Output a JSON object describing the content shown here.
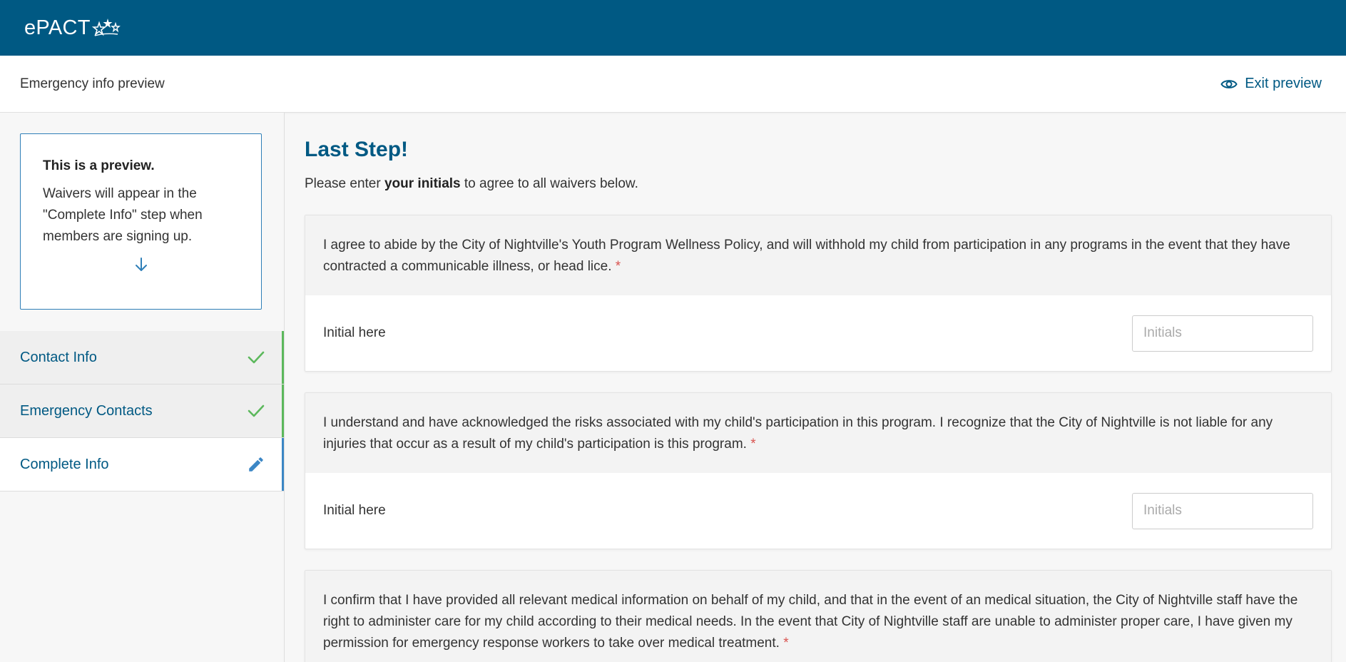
{
  "app": {
    "logo_text": "ePACT"
  },
  "subheader": {
    "title": "Emergency info preview",
    "exit_label": "Exit preview"
  },
  "preview_notice": {
    "title": "This is a preview.",
    "body": "Waivers will appear in the \"Complete Info\" step when members are signing up."
  },
  "steps": [
    {
      "label": "Contact Info",
      "status": "done",
      "icon": "check-icon"
    },
    {
      "label": "Emergency Contacts",
      "status": "done",
      "icon": "check-icon"
    },
    {
      "label": "Complete Info",
      "status": "current",
      "icon": "pencil-icon"
    }
  ],
  "main": {
    "heading": "Last Step!",
    "instructions_prefix": "Please enter ",
    "instructions_bold": "your initials",
    "instructions_suffix": " to agree to all waivers below."
  },
  "waivers": [
    {
      "text": "I agree to abide by the City of Nightville's Youth Program Wellness Policy, and will withhold my child from participation in any programs in the event that they have contracted a communicable illness, or head lice.",
      "required_mark": "*",
      "sign_label": "Initial here",
      "input_placeholder": "Initials",
      "input_value": ""
    },
    {
      "text": "I understand and have acknowledged the risks associated with my child's participation in this program. I recognize that the City of Nightville is not liable for any injuries that occur as a result of my child's participation is this program.",
      "required_mark": "*",
      "sign_label": "Initial here",
      "input_placeholder": "Initials",
      "input_value": ""
    },
    {
      "text": "I confirm that I have provided all relevant medical information on behalf of my child, and that in the event of an medical situation, the City of Nightville staff have the right to administer care for my child according to their medical needs. In the event that City of Nightville staff are unable to administer proper care, I have given my permission for emergency response workers to take over medical treatment.",
      "required_mark": "*"
    }
  ],
  "colors": {
    "brand": "#005983",
    "done": "#5cb85c",
    "current": "#3b86c5",
    "required": "#d9534f"
  }
}
